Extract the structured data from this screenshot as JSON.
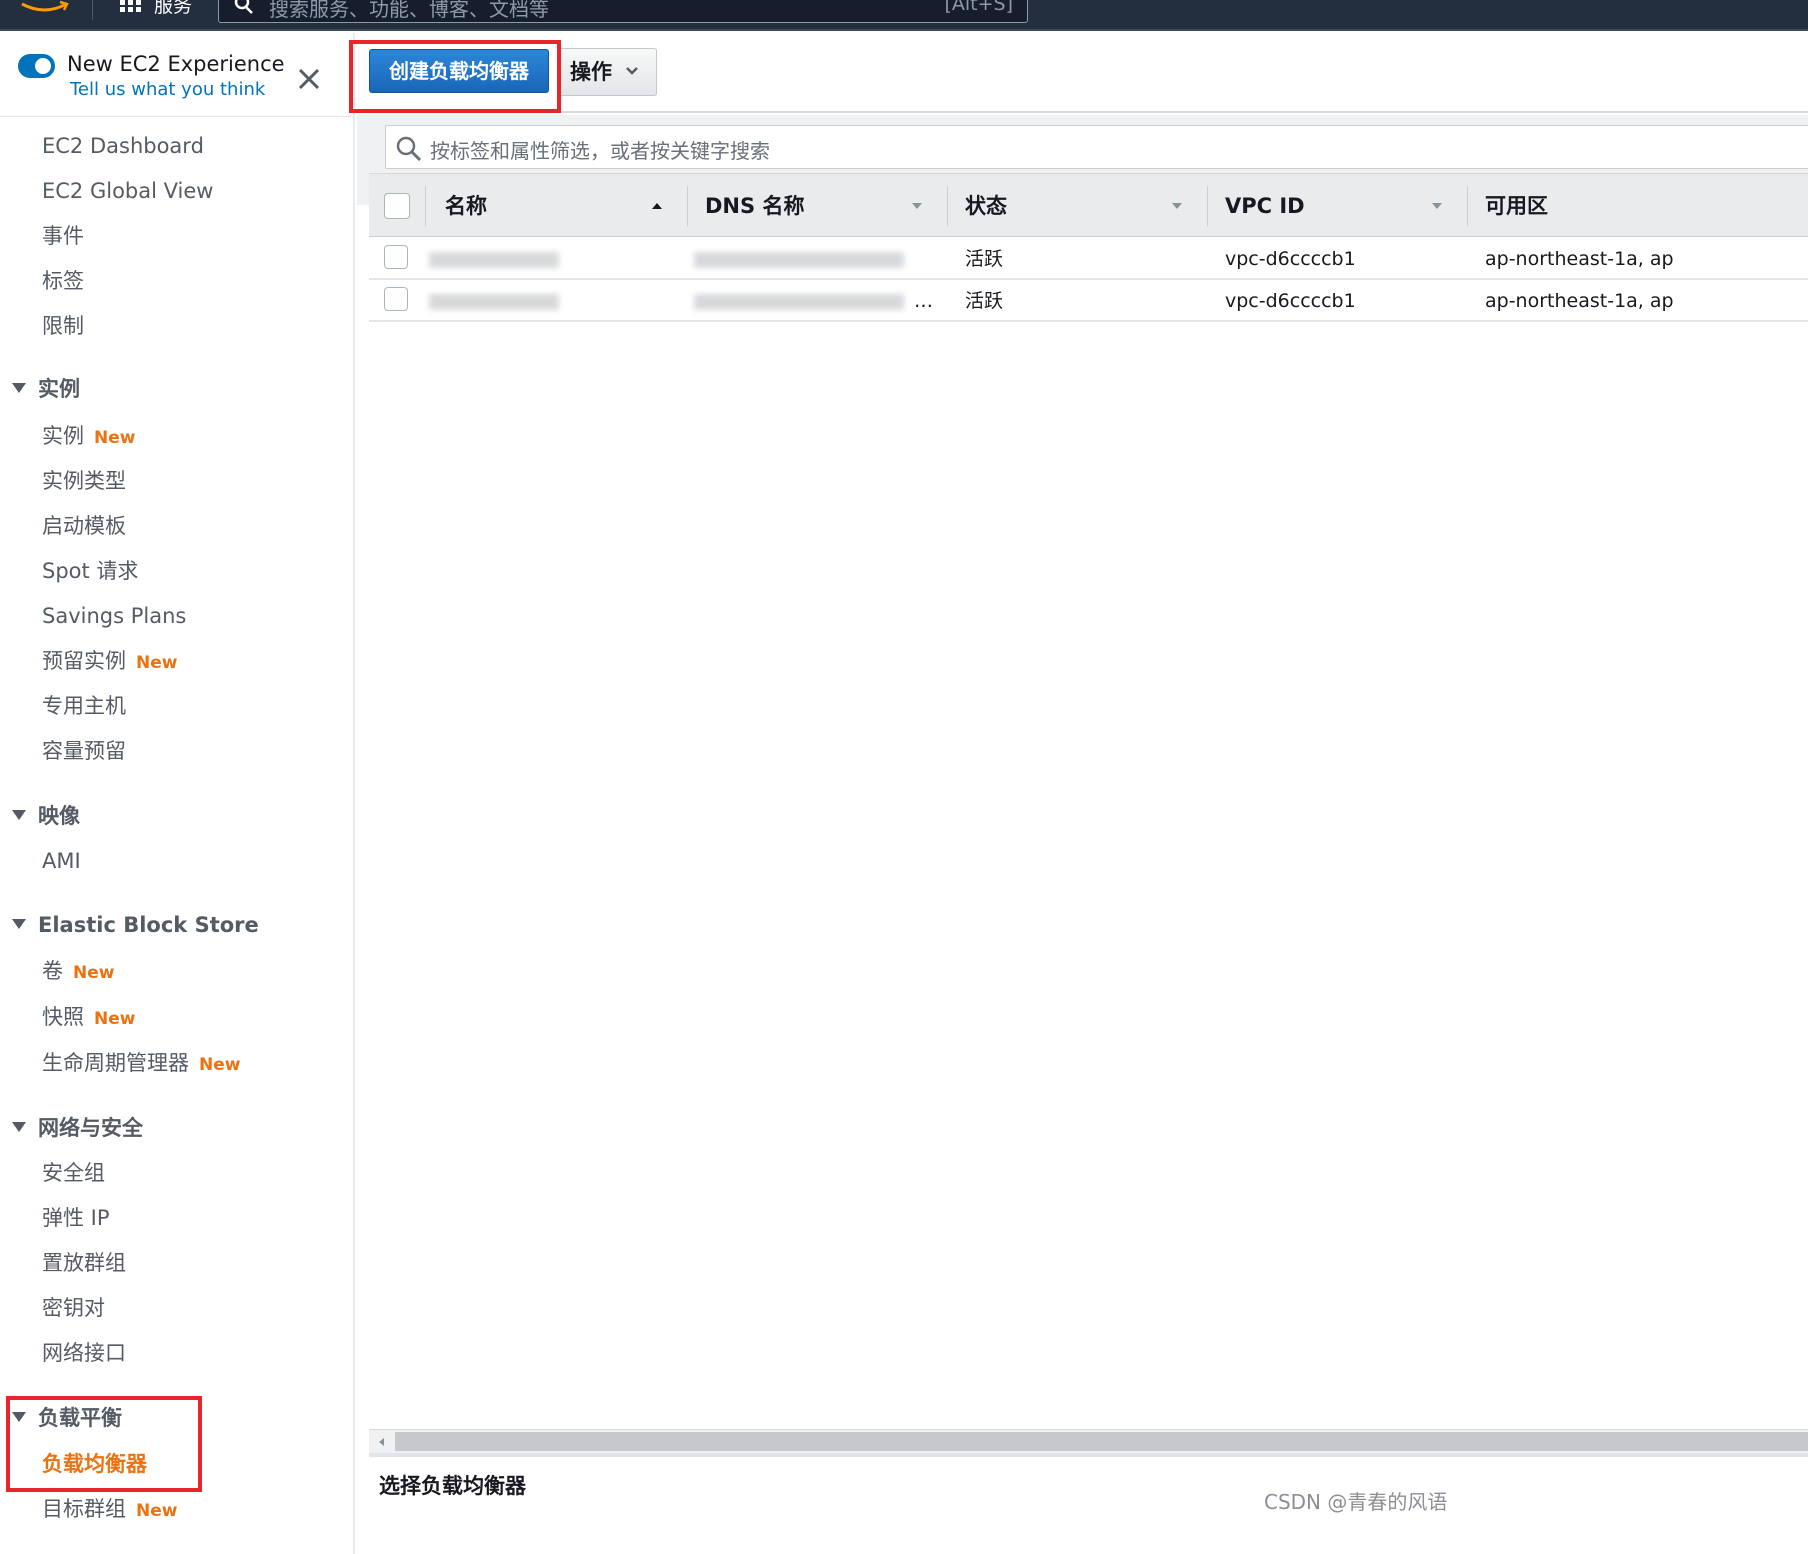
{
  "topbar": {
    "services_label": "服务",
    "search_placeholder": "搜索服务、功能、博客、文档等",
    "search_shortcut": "[Alt+S]"
  },
  "experience": {
    "title": "New EC2 Experience",
    "feedback_link": "Tell us what you think",
    "toggle_on": true
  },
  "sidebar": {
    "top_items": [
      {
        "label": "EC2 Dashboard"
      },
      {
        "label": "EC2 Global View"
      },
      {
        "label": "事件"
      },
      {
        "label": "标签"
      },
      {
        "label": "限制"
      }
    ],
    "sections": [
      {
        "title": "实例",
        "items": [
          {
            "label": "实例",
            "badge": "New"
          },
          {
            "label": "实例类型"
          },
          {
            "label": "启动模板"
          },
          {
            "label": "Spot 请求"
          },
          {
            "label": "Savings Plans"
          },
          {
            "label": "预留实例",
            "badge": "New"
          },
          {
            "label": "专用主机"
          },
          {
            "label": "容量预留"
          }
        ]
      },
      {
        "title": "映像",
        "items": [
          {
            "label": "AMI"
          }
        ]
      },
      {
        "title": "Elastic Block Store",
        "items": [
          {
            "label": "卷",
            "badge": "New"
          },
          {
            "label": "快照",
            "badge": "New"
          },
          {
            "label": "生命周期管理器",
            "badge": "New"
          }
        ]
      },
      {
        "title": "网络与安全",
        "items": [
          {
            "label": "安全组"
          },
          {
            "label": "弹性 IP"
          },
          {
            "label": "置放群组"
          },
          {
            "label": "密钥对"
          },
          {
            "label": "网络接口"
          }
        ]
      },
      {
        "title": "负载平衡",
        "items": [
          {
            "label": "负载均衡器",
            "active": true
          },
          {
            "label": "目标群组",
            "badge": "New"
          }
        ]
      }
    ]
  },
  "toolbar": {
    "create_button": "创建负载均衡器",
    "actions_button": "操作"
  },
  "filter": {
    "placeholder": "按标签和属性筛选，或者按关键字搜索"
  },
  "table": {
    "columns": [
      "名称",
      "DNS 名称",
      "状态",
      "VPC ID",
      "可用区"
    ],
    "rows": [
      {
        "name": "",
        "dns": "",
        "state": "活跃",
        "vpc": "vpc-d6ccccb1",
        "az": "ap-northeast-1a, ap"
      },
      {
        "name": "",
        "dns": "…",
        "state": "活跃",
        "vpc": "vpc-d6ccccb1",
        "az": "ap-northeast-1a, ap"
      }
    ]
  },
  "detail": {
    "title": "选择负载均衡器"
  },
  "watermark": "CSDN @青春的风语",
  "colors": {
    "primary": "#1a66b8",
    "nav_active": "#ec7211",
    "badge_new": "#ec7211",
    "highlight_box": "#e8262a",
    "topbar_bg": "#232f3e"
  }
}
